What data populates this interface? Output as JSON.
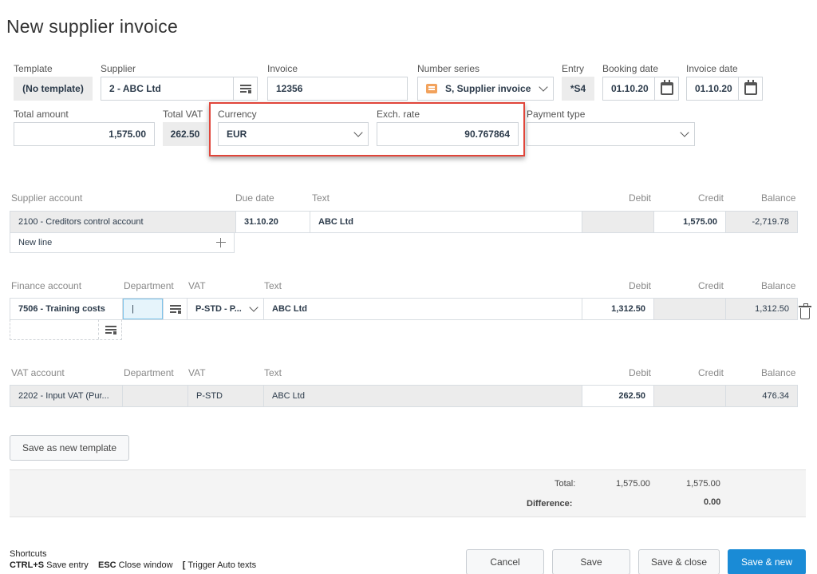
{
  "window": {
    "title": "New supplier invoice"
  },
  "header": {
    "template": {
      "label": "Template",
      "value": "(No template)"
    },
    "supplier": {
      "label": "Supplier",
      "value": "2 - ABC Ltd"
    },
    "invoice": {
      "label": "Invoice",
      "value": "12356"
    },
    "number_series": {
      "label": "Number series",
      "value": "S, Supplier invoice"
    },
    "entry": {
      "label": "Entry",
      "value": "*S4"
    },
    "booking_date": {
      "label": "Booking date",
      "value": "01.10.20"
    },
    "invoice_date": {
      "label": "Invoice date",
      "value": "01.10.20"
    },
    "total_amount": {
      "label": "Total amount",
      "value": "1,575.00"
    },
    "total_vat": {
      "label": "Total VAT",
      "value": "262.50"
    },
    "currency": {
      "label": "Currency",
      "value": "EUR"
    },
    "exch_rate": {
      "label": "Exch. rate",
      "value": "90.767864"
    },
    "payment_type": {
      "label": "Payment type",
      "value": ""
    }
  },
  "supplier_section": {
    "headers": {
      "account": "Supplier account",
      "due_date": "Due date",
      "text": "Text",
      "debit": "Debit",
      "credit": "Credit",
      "balance": "Balance"
    },
    "row": {
      "account": "2100 - Creditors control account",
      "due_date": "31.10.20",
      "text": "ABC Ltd",
      "debit": "",
      "credit": "1,575.00",
      "balance": "-2,719.78"
    },
    "new_line": "New line"
  },
  "finance_section": {
    "headers": {
      "account": "Finance account",
      "department": "Department",
      "vat": "VAT",
      "text": "Text",
      "debit": "Debit",
      "credit": "Credit",
      "balance": "Balance"
    },
    "row": {
      "account": "7506 - Training costs",
      "department": "|",
      "vat": "P-STD - P...",
      "text": "ABC Ltd",
      "debit": "1,312.50",
      "credit": "",
      "balance": "1,312.50"
    }
  },
  "vat_section": {
    "headers": {
      "account": "VAT account",
      "department": "Department",
      "vat": "VAT",
      "text": "Text",
      "debit": "Debit",
      "credit": "Credit",
      "balance": "Balance"
    },
    "row": {
      "account": "2202 - Input VAT (Pur...",
      "department": "",
      "vat": "P-STD",
      "text": "ABC Ltd",
      "debit": "262.50",
      "credit": "",
      "balance": "476.34"
    }
  },
  "template_button": "Save as new template",
  "totals": {
    "total_label": "Total:",
    "total_debit": "1,575.00",
    "total_credit": "1,575.00",
    "difference_label": "Difference:",
    "difference_value": "0.00"
  },
  "shortcuts": {
    "title": "Shortcuts",
    "items": [
      {
        "key": "CTRL+S",
        "desc": "Save entry"
      },
      {
        "key": "ESC",
        "desc": "Close window"
      },
      {
        "key": "[",
        "desc": "Trigger Auto texts"
      }
    ]
  },
  "footer": {
    "cancel": "Cancel",
    "save": "Save",
    "save_close": "Save & close",
    "save_new": "Save & new"
  },
  "colors": {
    "accent": "#1a8bd6",
    "highlight": "#e0453a"
  }
}
